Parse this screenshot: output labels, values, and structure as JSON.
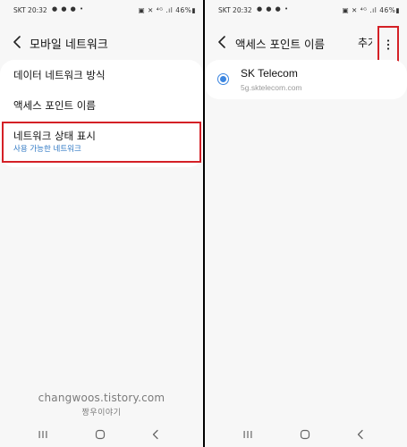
{
  "left": {
    "status": {
      "carrier": "SKT 20:32",
      "notifications": "● ● ● •",
      "system": "▣ ✕ ⁴ᴳ .ıl 46%▮"
    },
    "header": {
      "title": "모바일 네트워크"
    },
    "menu": [
      {
        "label": "데이터 네트워크 방식"
      },
      {
        "label": "액세스 포인트 이름"
      },
      {
        "label": "네트워크 상태 표시",
        "sub": "사용 가능한 네트워크"
      }
    ],
    "watermark": {
      "line1": "changwoos.tistory.com",
      "line2": "짱우이야기"
    }
  },
  "right": {
    "status": {
      "carrier": "SKT 20:32",
      "notifications": "● ● ● •",
      "system": "▣ ✕ ⁴ᴳ .ıl 46%▮"
    },
    "header": {
      "title": "액세스 포인트 이름",
      "add_label": "추가"
    },
    "apn": {
      "name": "SK Telecom",
      "apn": "5g.sktelecom.com",
      "selected": true
    }
  },
  "colors": {
    "accent_blue": "#3c86e0",
    "link_blue": "#2f78c4",
    "highlight_red": "#d42026",
    "background": "#f7f7f7",
    "card": "#ffffff"
  },
  "icons": [
    "back-arrow-icon",
    "more-vert-icon",
    "radio-selected-icon",
    "recent-apps-icon",
    "home-icon",
    "nav-back-icon"
  ]
}
